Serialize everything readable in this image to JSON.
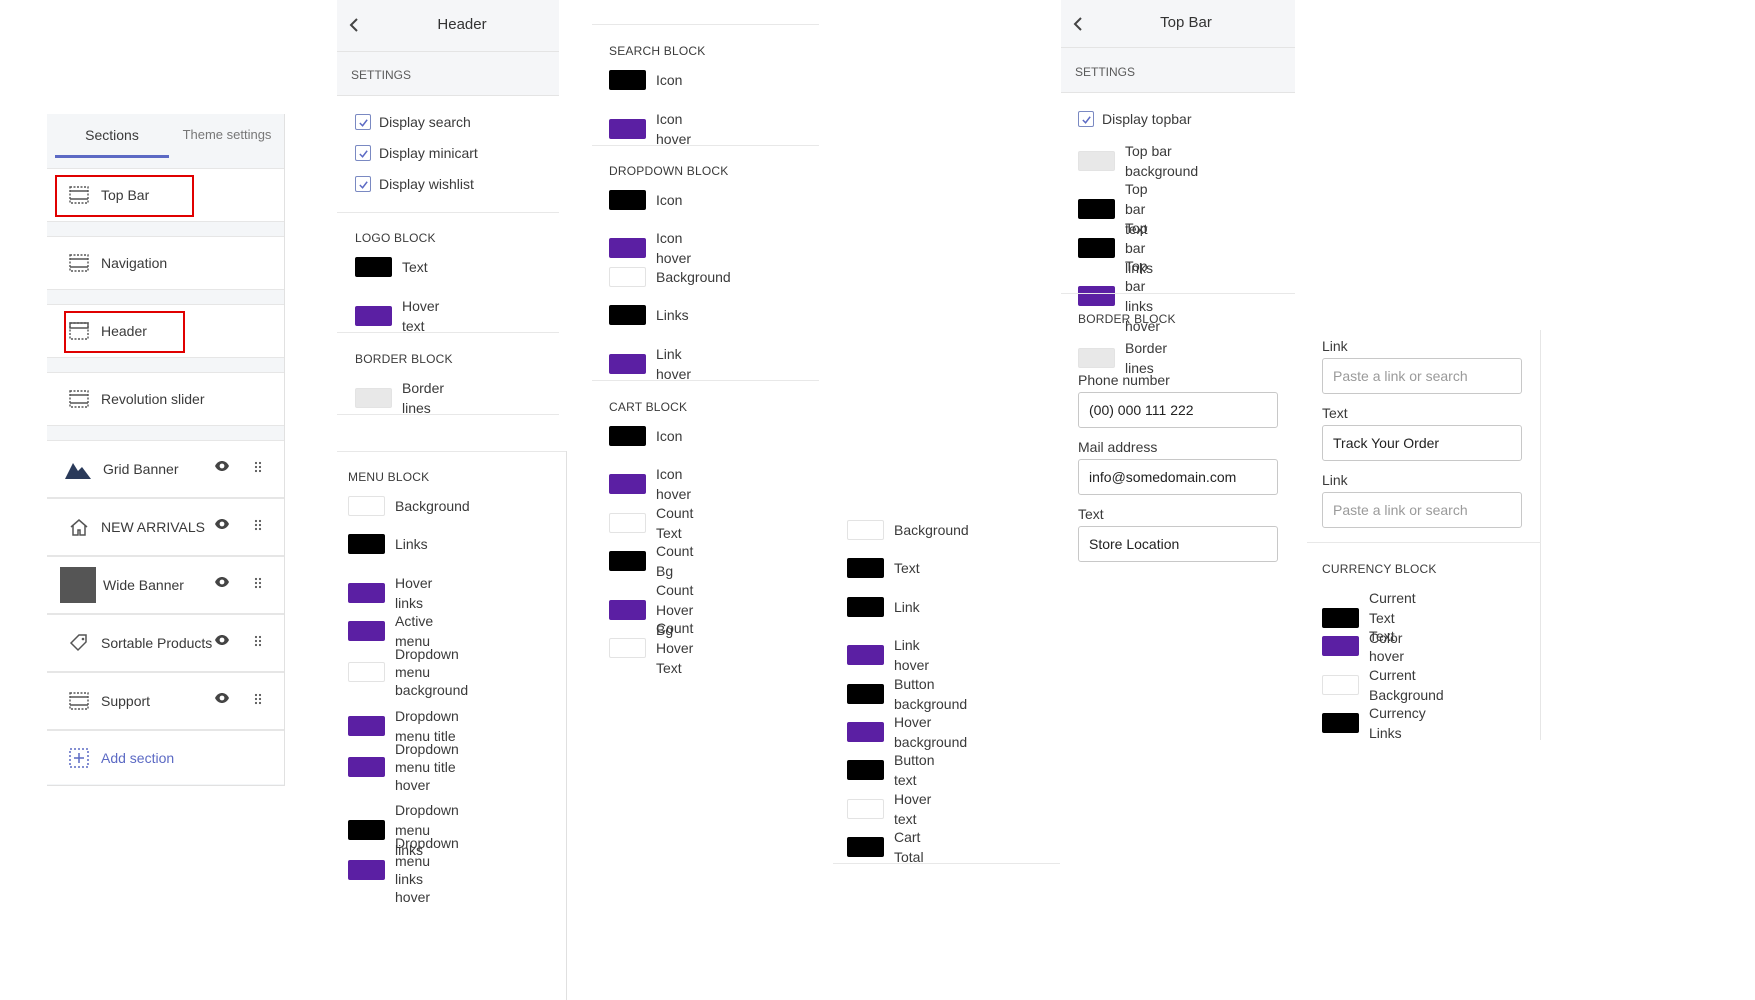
{
  "colors": {
    "black": "#000000",
    "purple": "#5b1fa3",
    "white": "#ffffff",
    "light": "#e8e8e8",
    "accent": "#5c6ac4",
    "red": "#e00000"
  },
  "sections_panel": {
    "tabs": [
      "Sections",
      "Theme settings"
    ],
    "items": [
      {
        "label": "Top Bar",
        "icon": "layout-icon",
        "highlighted": true
      },
      {
        "label": "Navigation",
        "icon": "layout-icon"
      },
      {
        "label": "Header",
        "icon": "header-layout-icon",
        "highlighted": true
      },
      {
        "label": "Revolution slider",
        "icon": "layout-icon"
      },
      {
        "label": "Grid Banner",
        "icon": "image-thumbnail"
      },
      {
        "label": "NEW ARRIVALS",
        "icon": "home-icon"
      },
      {
        "label": "Wide Banner",
        "icon": "image-thumbnail"
      },
      {
        "label": "Sortable Products",
        "icon": "tag-icon"
      },
      {
        "label": "Support",
        "icon": "layout-icon"
      }
    ],
    "add_section": "Add section"
  },
  "header_panel": {
    "title": "Header",
    "settings": "SETTINGS",
    "checks": [
      "Display search",
      "Display minicart",
      "Display wishlist"
    ],
    "logo_block": {
      "title": "LOGO BLOCK",
      "items": [
        {
          "label": "Text",
          "color": "black"
        },
        {
          "label": "Hover text",
          "color": "purple"
        }
      ]
    },
    "border_block": {
      "title": "BORDER BLOCK",
      "items": [
        {
          "label": "Border lines",
          "color": "light"
        }
      ]
    },
    "menu_block": {
      "title": "MENU BLOCK",
      "items": [
        {
          "label": "Background",
          "color": "white"
        },
        {
          "label": "Links",
          "color": "black"
        },
        {
          "label": "Hover links",
          "color": "purple"
        },
        {
          "label": "Active menu",
          "color": "purple"
        },
        {
          "label": "Dropdown menu",
          "label2": "background",
          "color": "white"
        },
        {
          "label": "Dropdown menu title",
          "color": "purple"
        },
        {
          "label": "Dropdown menu title",
          "label2": "hover",
          "color": "purple"
        },
        {
          "label": "Dropdown menu links",
          "color": "black"
        },
        {
          "label": "Dropdown menu links",
          "label2": "hover",
          "color": "purple"
        }
      ]
    }
  },
  "blocks_panel": {
    "search_block": {
      "title": "SEARCH BLOCK",
      "items": [
        {
          "label": "Icon",
          "color": "black"
        },
        {
          "label": "Icon hover",
          "color": "purple"
        }
      ]
    },
    "dropdown_block": {
      "title": "DROPDOWN BLOCK",
      "items": [
        {
          "label": "Icon",
          "color": "black"
        },
        {
          "label": "Icon hover",
          "color": "purple"
        },
        {
          "label": "Background",
          "color": "white"
        },
        {
          "label": "Links",
          "color": "black"
        },
        {
          "label": "Link hover",
          "color": "purple"
        }
      ]
    },
    "cart_block": {
      "title": "CART BLOCK",
      "items": [
        {
          "label": "Icon",
          "color": "black"
        },
        {
          "label": "Icon hover",
          "color": "purple"
        },
        {
          "label": "Count Text",
          "color": "white"
        },
        {
          "label": "Count Bg",
          "color": "black"
        },
        {
          "label": "Count Hover Bg",
          "color": "purple"
        },
        {
          "label": "Count Hover Text",
          "color": "white"
        }
      ]
    }
  },
  "cart_extra": {
    "items": [
      {
        "label": "Background",
        "color": "white"
      },
      {
        "label": "Text",
        "color": "black"
      },
      {
        "label": "Link",
        "color": "black"
      },
      {
        "label": "Link hover",
        "color": "purple"
      },
      {
        "label": "Button background",
        "color": "black"
      },
      {
        "label": "Hover background",
        "color": "purple"
      },
      {
        "label": "Button text",
        "color": "black"
      },
      {
        "label": "Hover text",
        "color": "white"
      },
      {
        "label": "Cart Total",
        "color": "black"
      }
    ]
  },
  "topbar_panel": {
    "title": "Top Bar",
    "settings": "SETTINGS",
    "check": "Display topbar",
    "items": [
      {
        "label": "Top bar background",
        "color": "light"
      },
      {
        "label": "Top bar text",
        "color": "black"
      },
      {
        "label": "Top bar links",
        "color": "black"
      },
      {
        "label": "Top bar links hover",
        "color": "purple"
      }
    ],
    "border_block": {
      "title": "BORDER BLOCK",
      "items": [
        {
          "label": "Border lines",
          "color": "light"
        }
      ]
    },
    "fields": [
      {
        "label": "Phone number",
        "value": "(00) 000 111 222"
      },
      {
        "label": "Mail address",
        "value": "info@somedomain.com"
      },
      {
        "label": "Text",
        "value": "Store Location"
      }
    ]
  },
  "right_panel": {
    "fields": [
      {
        "label": "Link",
        "value": "",
        "placeholder": "Paste a link or search"
      },
      {
        "label": "Text",
        "value": "Track Your Order",
        "placeholder": ""
      },
      {
        "label": "Link",
        "value": "",
        "placeholder": "Paste a link or search"
      }
    ],
    "currency_block": {
      "title": "CURRENCY BLOCK",
      "items": [
        {
          "label": "Current Text Color",
          "color": "black"
        },
        {
          "label": "Text hover",
          "color": "purple"
        },
        {
          "label": "Current Background",
          "color": "white"
        },
        {
          "label": "Currency Links",
          "color": "black"
        }
      ]
    }
  }
}
